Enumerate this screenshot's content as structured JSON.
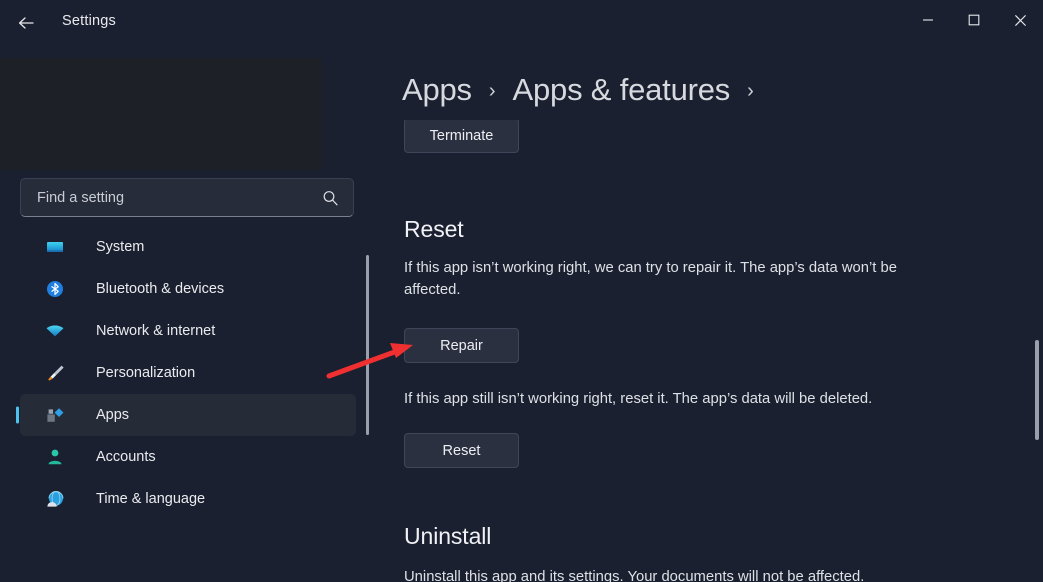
{
  "window": {
    "title": "Settings",
    "back_icon": "back-arrow-icon",
    "minimize_label": "Minimize",
    "maximize_label": "Maximize",
    "close_label": "Close"
  },
  "search": {
    "placeholder": "Find a setting",
    "icon": "search-icon"
  },
  "sidebar": {
    "items": [
      {
        "label": "System",
        "icon": "monitor-icon",
        "selected": false
      },
      {
        "label": "Bluetooth & devices",
        "icon": "bluetooth-icon",
        "selected": false
      },
      {
        "label": "Network & internet",
        "icon": "wifi-icon",
        "selected": false
      },
      {
        "label": "Personalization",
        "icon": "paintbrush-icon",
        "selected": false
      },
      {
        "label": "Apps",
        "icon": "apps-icon",
        "selected": true
      },
      {
        "label": "Accounts",
        "icon": "person-icon",
        "selected": false
      },
      {
        "label": "Time & language",
        "icon": "globe-clock-icon",
        "selected": false
      }
    ]
  },
  "breadcrumb": {
    "items": [
      "Apps",
      "Apps & features"
    ],
    "separator": "›"
  },
  "main": {
    "terminate_button": "Terminate",
    "reset_heading": "Reset",
    "repair_description": "If this app isn’t working right, we can try to repair it. The app’s data won’t be affected.",
    "repair_button": "Repair",
    "reset_description": "If this app still isn’t working right, reset it. The app’s data will be deleted.",
    "reset_button": "Reset",
    "uninstall_heading": "Uninstall",
    "uninstall_description": "Uninstall this app and its settings. Your documents will not be affected."
  },
  "annotation": {
    "arrow_color": "#f03030",
    "points_to": "Repair"
  },
  "colors": {
    "background": "#1b2030",
    "panel": "#1d2026",
    "accent": "#4cc2f1",
    "button_fill": "#2a3040",
    "selected_row": "#262b38",
    "scrollbar": "#9aa0ab"
  }
}
